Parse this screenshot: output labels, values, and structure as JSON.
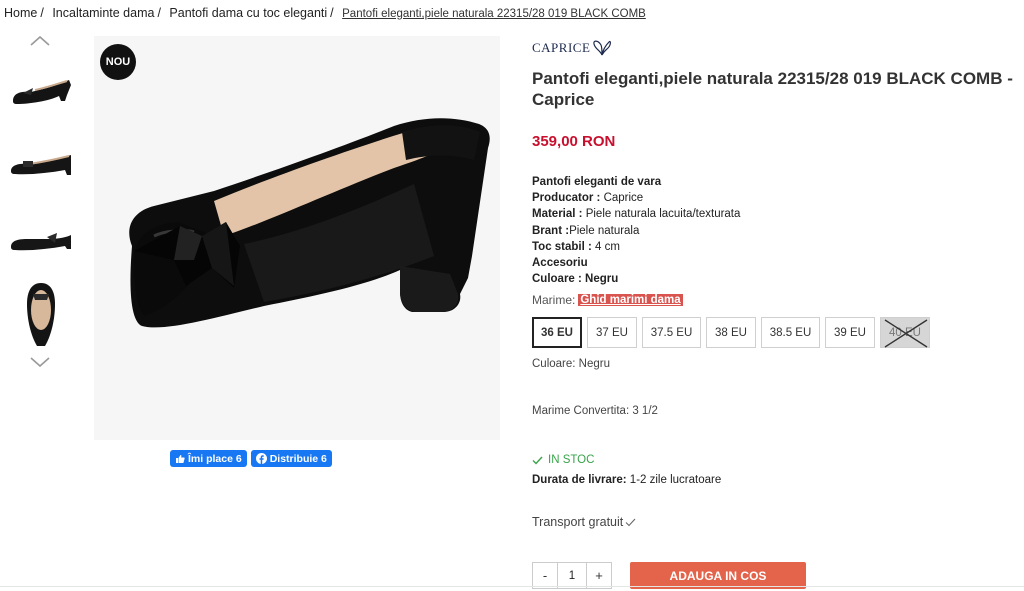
{
  "breadcrumb": {
    "items": [
      "Home",
      "Incaltaminte dama",
      "Pantofi dama cu toc eleganti"
    ],
    "separator": "/",
    "current": "Pantofi eleganti,piele naturala 22315/28 019 BLACK COMB"
  },
  "thumbnails": {
    "up_icon": "chevron-up-icon",
    "down_icon": "chevron-down-icon",
    "count": 4
  },
  "image": {
    "badge": "NOU"
  },
  "social": {
    "like_label": "Îmi place 6",
    "share_label": "Distribuie 6",
    "color": "#1877f2"
  },
  "product": {
    "brand": "CAPRICE",
    "title": "Pantofi eleganti,piele naturala 22315/28 019 BLACK COMB - Caprice",
    "price": "359,00 RON",
    "price_color": "#c8102e"
  },
  "specs": {
    "heading": "Pantofi eleganti de vara",
    "producer_label": "Producator :",
    "producer_value": " Caprice",
    "material_label": "Material :",
    "material_value": " Piele naturala lacuita/texturata",
    "brant_label": "Brant :",
    "brant_value": "Piele naturala",
    "heel_label": "Toc stabil :",
    "heel_value": " 4 cm",
    "accessories_label": "Accesoriu",
    "color_label": "Culoare : Negru"
  },
  "sizes": {
    "label": "Marime:",
    "guide_label": "Ghid marimi dama",
    "options": [
      {
        "label": "36 EU",
        "selected": true,
        "available": true
      },
      {
        "label": "37 EU",
        "selected": false,
        "available": true
      },
      {
        "label": "37.5 EU",
        "selected": false,
        "available": true
      },
      {
        "label": "38 EU",
        "selected": false,
        "available": true
      },
      {
        "label": "38.5 EU",
        "selected": false,
        "available": true
      },
      {
        "label": "39 EU",
        "selected": false,
        "available": true
      },
      {
        "label": "40 EU",
        "selected": false,
        "available": false
      }
    ]
  },
  "color_line": "Culoare: Negru",
  "converted_size": "Marime Convertita: 3 1/2",
  "stock": {
    "label": "IN STOC",
    "color": "#3aa34a"
  },
  "delivery": {
    "label": "Durata de livrare:",
    "value": " 1-2 zile lucratoare"
  },
  "transport": "Transport gratuit",
  "cart": {
    "minus": "-",
    "quantity": "1",
    "plus": "+",
    "add_label": "ADAUGA IN COS",
    "button_color": "#e3634b"
  }
}
